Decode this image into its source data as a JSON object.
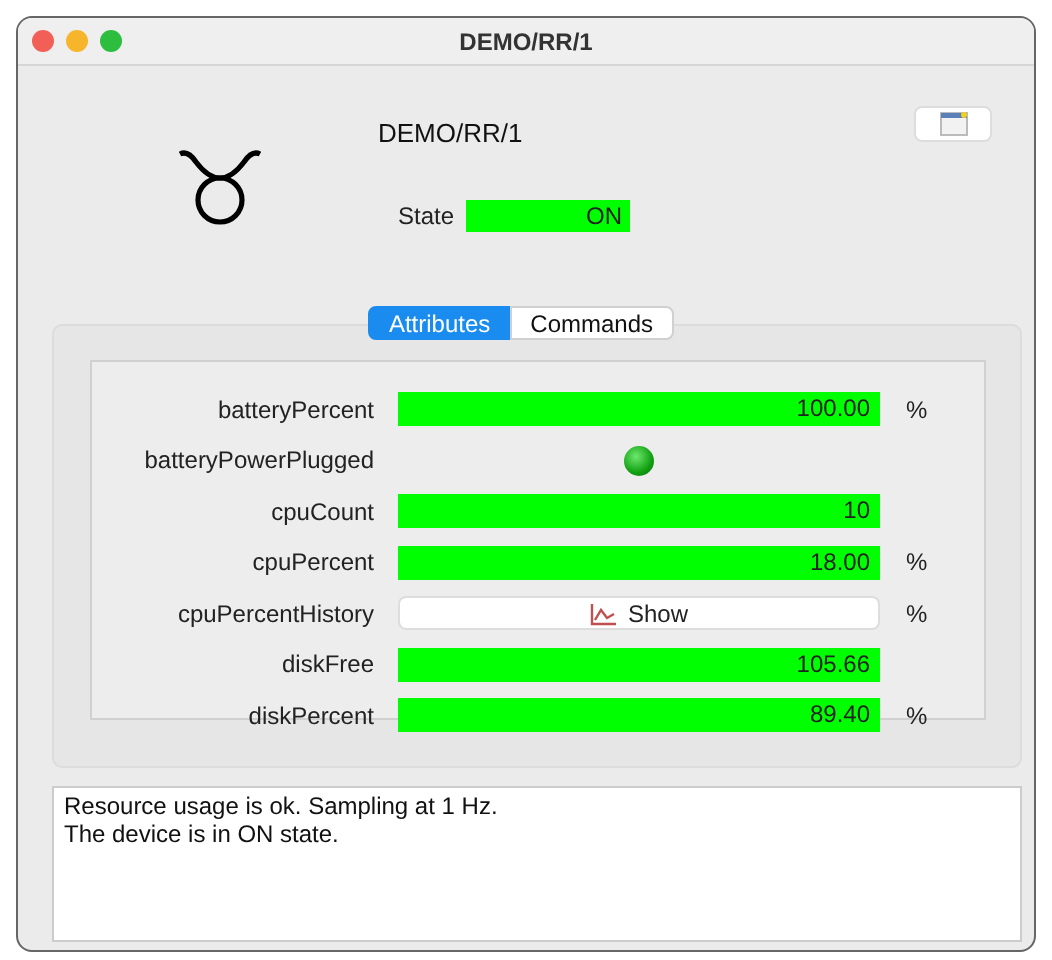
{
  "window": {
    "title": "DEMO/RR/1"
  },
  "device": {
    "name": "DEMO/RR/1",
    "state_label": "State",
    "state": "ON"
  },
  "tabs": [
    {
      "label": "Attributes",
      "selected": true
    },
    {
      "label": "Commands",
      "selected": false
    }
  ],
  "attributes": [
    {
      "kind": "value",
      "name": "batteryPercent",
      "value": "100.00",
      "unit": "%"
    },
    {
      "kind": "led",
      "name": "batteryPowerPlugged",
      "on": true
    },
    {
      "kind": "value",
      "name": "cpuCount",
      "value": "10"
    },
    {
      "kind": "value",
      "name": "cpuPercent",
      "value": "18.00",
      "unit": "%"
    },
    {
      "kind": "button",
      "name": "cpuPercentHistory",
      "label": "Show",
      "unit": "%"
    },
    {
      "kind": "value",
      "name": "diskFree",
      "value": "105.66"
    },
    {
      "kind": "value",
      "name": "diskPercent",
      "value": "89.40",
      "unit": "%"
    }
  ],
  "status_text": [
    "Resource usage is ok. Sampling at 1 Hz.",
    "The device is in ON state."
  ]
}
